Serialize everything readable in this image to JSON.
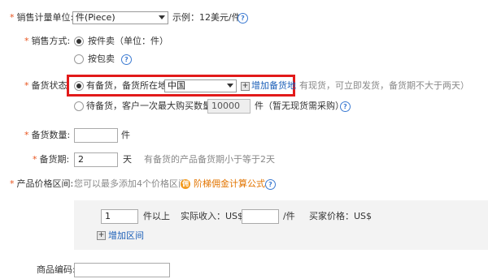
{
  "sales_unit": {
    "label": "销售计量单位:",
    "selected": "件(Piece)",
    "example": "示例：12美元/件"
  },
  "sales_method": {
    "label": "销售方式:",
    "options": [
      "按件卖（单位：件）",
      "按包卖"
    ]
  },
  "stock_status": {
    "label": "备货状态:",
    "in_stock_label": "有备货，备货所在地",
    "location": "中国",
    "add_location": "增加备货地",
    "in_stock_hint": "有现货，可立即发货，备货期不大于两天）",
    "preorder_label": "待备货，客户一次最大购买数量为",
    "preorder_qty": "10000",
    "preorder_unit": "件（暂无现货需采购）"
  },
  "stock_qty": {
    "label": "备货数量:",
    "value": "",
    "unit": "件"
  },
  "stock_period": {
    "label": "备货期:",
    "value": "2",
    "unit": "天",
    "hint": "有备货的产品备货期小于等于2天"
  },
  "price_range": {
    "label": "产品价格区间:",
    "hint": "您可以最多添加4个价格区间",
    "commission_link": "阶梯佣金计算公式",
    "coin_glyph": "佣",
    "qty_value": "1",
    "qty_suffix": "件以上",
    "income_label": "实际收入：US$",
    "income_value": "",
    "income_unit": "/件",
    "buyer_price_label": "买家价格：US$",
    "add_range": "增加区间"
  },
  "product_code": {
    "label": "商品编码:",
    "value": ""
  },
  "colors": {
    "required_star": "#e8541e",
    "link": "#1b5fb8",
    "highlight_border": "#e21a1a",
    "help_icon": "#3d7bd2"
  }
}
